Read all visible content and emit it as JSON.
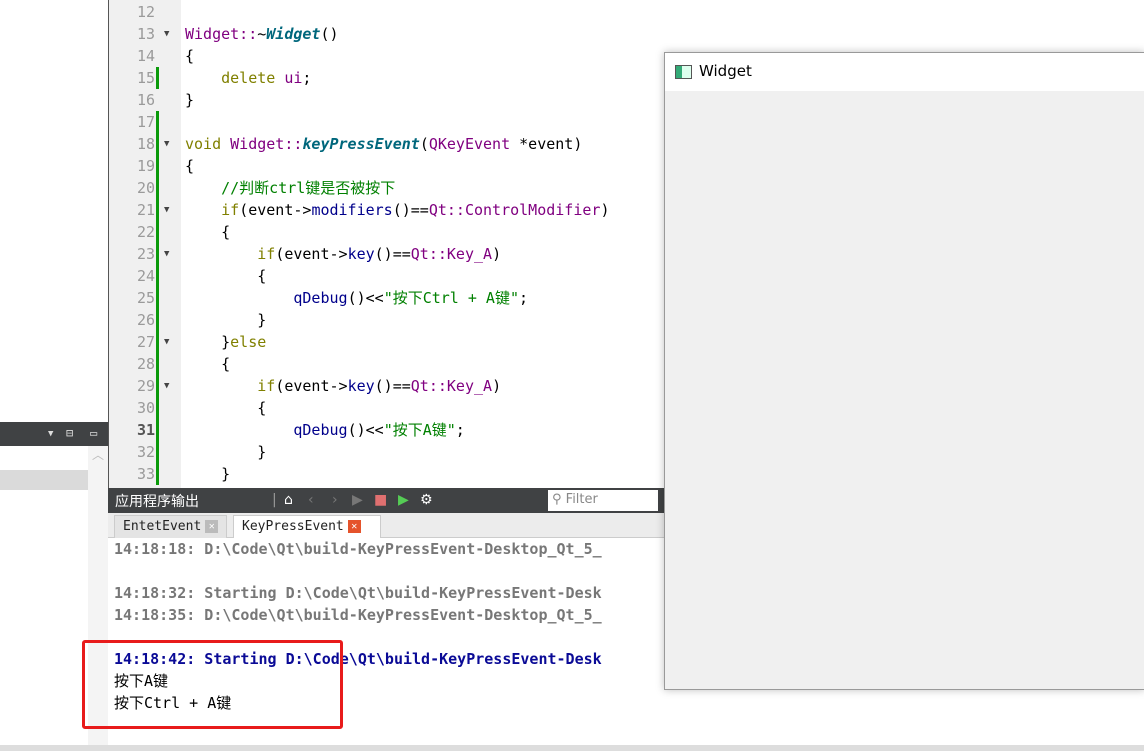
{
  "left_panel": {
    "toolbar_icons": [
      "dropdown-arrow-icon",
      "split-icon",
      "close-pane-icon"
    ]
  },
  "editor": {
    "current_line": 31,
    "lines": [
      {
        "n": 12,
        "t": []
      },
      {
        "n": 13,
        "fold": true,
        "t": [
          [
            "Widget::",
            "ty"
          ],
          [
            "~",
            ""
          ],
          [
            "Widget",
            "fn"
          ],
          [
            "()",
            ""
          ]
        ]
      },
      {
        "n": 14,
        "t": [
          [
            "{",
            ""
          ]
        ]
      },
      {
        "n": 15,
        "chg": true,
        "t": [
          [
            "    delete ",
            "kw"
          ],
          [
            "ui",
            "ty"
          ],
          [
            ";",
            ""
          ]
        ]
      },
      {
        "n": 16,
        "t": [
          [
            "}",
            ""
          ]
        ]
      },
      {
        "n": 17,
        "chg": true,
        "t": []
      },
      {
        "n": 18,
        "fold": true,
        "chg": true,
        "t": [
          [
            "void ",
            "kw"
          ],
          [
            "Widget::",
            "ty"
          ],
          [
            "keyPressEvent",
            "fn"
          ],
          [
            "(",
            ""
          ],
          [
            "QKeyEvent",
            "ty"
          ],
          [
            " *event)",
            ""
          ]
        ]
      },
      {
        "n": 19,
        "chg": true,
        "t": [
          [
            "{",
            ""
          ]
        ]
      },
      {
        "n": 20,
        "chg": true,
        "t": [
          [
            "    //判断ctrl键是否被按下",
            "cm"
          ]
        ]
      },
      {
        "n": 21,
        "fold": true,
        "chg": true,
        "t": [
          [
            "    if",
            "kw"
          ],
          [
            "(event->",
            ""
          ],
          [
            "modifiers",
            "cl"
          ],
          [
            "()==",
            ""
          ],
          [
            "Qt::ControlModifier",
            "ty"
          ],
          [
            ")",
            ""
          ]
        ]
      },
      {
        "n": 22,
        "chg": true,
        "t": [
          [
            "    {",
            ""
          ]
        ]
      },
      {
        "n": 23,
        "fold": true,
        "chg": true,
        "t": [
          [
            "        if",
            "kw"
          ],
          [
            "(event->",
            ""
          ],
          [
            "key",
            "cl"
          ],
          [
            "()==",
            ""
          ],
          [
            "Qt::Key_A",
            "ty"
          ],
          [
            ")",
            ""
          ]
        ]
      },
      {
        "n": 24,
        "chg": true,
        "t": [
          [
            "        {",
            ""
          ]
        ]
      },
      {
        "n": 25,
        "chg": true,
        "t": [
          [
            "            qDebug",
            "cl"
          ],
          [
            "()<<",
            ""
          ],
          [
            "\"按下Ctrl + A键\"",
            "st"
          ],
          [
            ";",
            ""
          ]
        ]
      },
      {
        "n": 26,
        "chg": true,
        "t": [
          [
            "        }",
            ""
          ]
        ]
      },
      {
        "n": 27,
        "fold": true,
        "chg": true,
        "t": [
          [
            "    }",
            ""
          ],
          [
            "else",
            "kw"
          ]
        ]
      },
      {
        "n": 28,
        "chg": true,
        "t": [
          [
            "    {",
            ""
          ]
        ]
      },
      {
        "n": 29,
        "fold": true,
        "chg": true,
        "t": [
          [
            "        if",
            "kw"
          ],
          [
            "(event->",
            ""
          ],
          [
            "key",
            "cl"
          ],
          [
            "()==",
            ""
          ],
          [
            "Qt::Key_A",
            "ty"
          ],
          [
            ")",
            ""
          ]
        ]
      },
      {
        "n": 30,
        "chg": true,
        "t": [
          [
            "        {",
            ""
          ]
        ]
      },
      {
        "n": 31,
        "chg": true,
        "t": [
          [
            "            qDebug",
            "cl"
          ],
          [
            "()<<",
            ""
          ],
          [
            "\"按下A键\"",
            "st"
          ],
          [
            ";",
            ""
          ]
        ]
      },
      {
        "n": 32,
        "chg": true,
        "t": [
          [
            "        }",
            ""
          ]
        ]
      },
      {
        "n": 33,
        "chg": true,
        "t": [
          [
            "    }",
            ""
          ]
        ]
      }
    ]
  },
  "output": {
    "title": "应用程序输出",
    "filter_placeholder": "Filter",
    "tabs": [
      {
        "label": "EntetEvent",
        "active": false
      },
      {
        "label": "KeyPressEvent",
        "active": true
      }
    ],
    "lines": [
      {
        "text": "14:18:18: D:\\Code\\Qt\\build-KeyPressEvent-Desktop_Qt_5_",
        "style": ""
      },
      {
        "text": "",
        "style": ""
      },
      {
        "text": "14:18:32: Starting D:\\Code\\Qt\\build-KeyPressEvent-Desk",
        "style": ""
      },
      {
        "text": "14:18:35: D:\\Code\\Qt\\build-KeyPressEvent-Desktop_Qt_5_",
        "style": ""
      },
      {
        "text": "",
        "style": ""
      },
      {
        "text": "14:18:42: Starting D:\\Code\\Qt\\build-KeyPressEvent-Desk",
        "style": "blue"
      },
      {
        "text": "按下A键",
        "style": "plain"
      },
      {
        "text": "按下Ctrl + A键",
        "style": "plain"
      }
    ]
  },
  "widget_window": {
    "title": "Widget"
  },
  "colors": {
    "highlight_box": "#e81b1b",
    "change_bar": "#0a9a0a",
    "latest_output": "#0a0a96"
  }
}
